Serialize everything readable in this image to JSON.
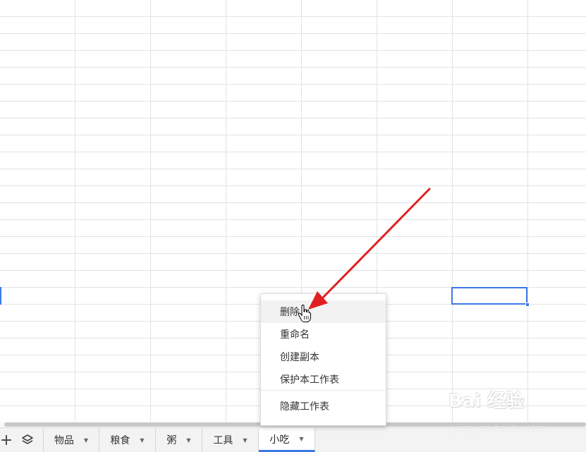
{
  "sheet_tabs": [
    {
      "label": "物品",
      "caret": "▼"
    },
    {
      "label": "粮食",
      "caret": "▼"
    },
    {
      "label": "粥",
      "caret": "▼"
    },
    {
      "label": "工具",
      "caret": "▼"
    },
    {
      "label": "小吃",
      "caret": "▼",
      "active": true
    }
  ],
  "toolbar": {
    "add_glyph": "+",
    "add_icon": "plus-icon",
    "layers_icon": "layers-icon"
  },
  "context_menu": {
    "items": [
      {
        "label": "删除",
        "hovered": true
      },
      {
        "label": "重命名"
      },
      {
        "label": "创建副本"
      },
      {
        "label": "保护本工作表"
      },
      {
        "label": "隐藏工作表"
      }
    ]
  },
  "watermark": {
    "main": "Bai 经验",
    "sub": "jingyan.baidu.com"
  },
  "colors": {
    "accent": "#3b78e7",
    "annotation_arrow": "#e02020",
    "grid_line": "#e3e3e3"
  }
}
